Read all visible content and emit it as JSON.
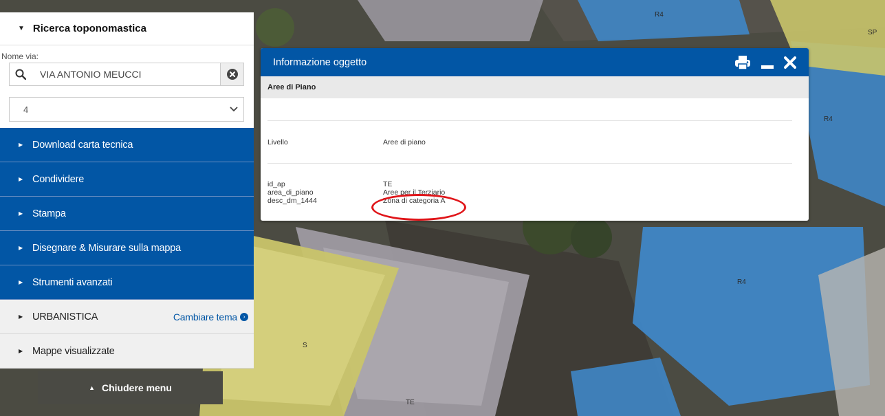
{
  "map": {
    "labels": [
      "R4",
      "SP",
      "R4",
      "R4",
      "S",
      "TE"
    ]
  },
  "panel": {
    "title": "Ricerca toponomastica",
    "street_label": "Nome via:",
    "street_value": "VIA ANTONIO MEUCCI",
    "number_value": "4",
    "menu": [
      {
        "label": "Download carta tecnica"
      },
      {
        "label": "Condividere"
      },
      {
        "label": "Stampa"
      },
      {
        "label": "Disegnare & Misurare sulla mappa"
      },
      {
        "label": "Strumenti avanzati"
      }
    ],
    "theme": {
      "label": "URBANISTICA",
      "action": "Cambiare tema"
    },
    "maps": {
      "label": "Mappe visualizzate"
    },
    "close_menu": "Chiudere menu"
  },
  "popup": {
    "title": "Informazione oggetto",
    "subtitle": "Aree di Piano",
    "level": {
      "key": "Livello",
      "value": "Aree di piano"
    },
    "attributes": [
      {
        "key": "id_ap",
        "value": "TE"
      },
      {
        "key": "area_di_piano",
        "value": "Aree per il Terziario"
      },
      {
        "key": "desc_dm_1444",
        "value": "Zona di categoria A"
      }
    ]
  },
  "colors": {
    "brand_blue": "#0256a5",
    "highlight_red": "#e0161a"
  }
}
